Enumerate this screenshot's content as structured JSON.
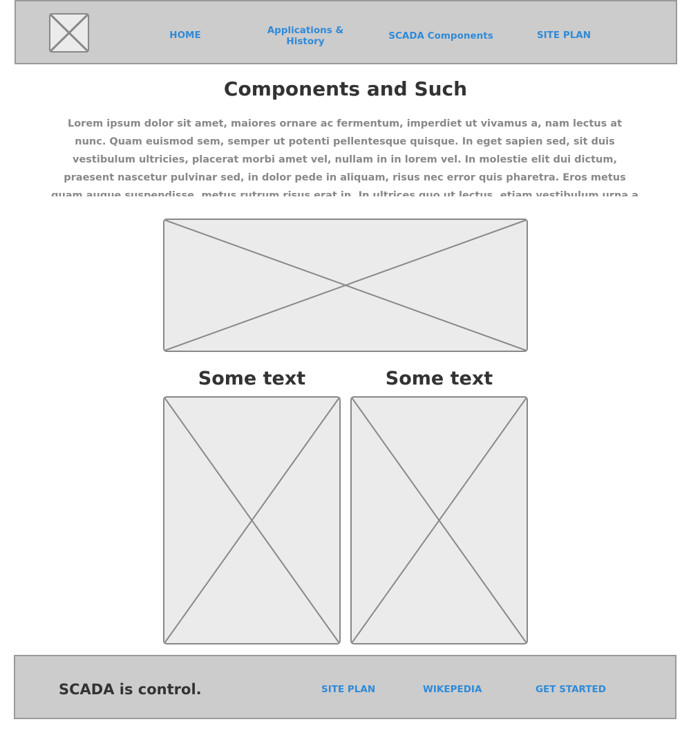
{
  "nav": {
    "home": "HOME",
    "applications": "Applications & History",
    "scada_components": "SCADA Components",
    "site_plan": "SITE PLAN"
  },
  "main": {
    "title": "Components and Such",
    "intro": "Lorem ipsum dolor sit amet, maiores ornare ac fermentum, imperdiet ut vivamus a, nam lectus at nunc. Quam euismod sem, semper ut potenti pellentesque quisque. In eget sapien sed, sit duis vestibulum ultricies, placerat morbi amet vel, nullam in in lorem vel. In molestie elit dui dictum, praesent nascetur pulvinar sed, in dolor pede in aliquam, risus nec error quis pharetra. Eros metus quam augue suspendisse, metus rutrum risus erat in. In ultrices quo ut lectus, etiam vestibulum urna a est, pretium luctus euismod nisl, pellentesque turpis hac ridiculus massa.",
    "columns": [
      {
        "title": "Some text"
      },
      {
        "title": "Some text"
      }
    ]
  },
  "footer": {
    "tagline": "SCADA is control.",
    "links": {
      "site_plan": "SITE PLAN",
      "wikipedia": "WIKEPEDIA",
      "get_started": "GET STARTED"
    }
  },
  "colors": {
    "link": "#2f8ad8",
    "heading": "#333333",
    "body_text": "#888888",
    "bar_background": "#cccccc",
    "placeholder_fill": "#ebebeb",
    "placeholder_stroke": "#888888"
  },
  "icons": {
    "logo": "image-placeholder-icon",
    "hero": "image-placeholder-icon",
    "column_images": "image-placeholder-icon"
  }
}
